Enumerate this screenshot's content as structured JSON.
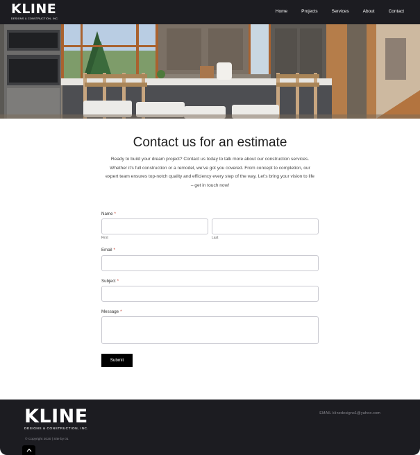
{
  "header": {
    "logo_word": "KLINE",
    "logo_sub": "DESIGNS & CONSTRUCTION, INC.",
    "nav": [
      "Home",
      "Projects",
      "Services",
      "About",
      "Contact"
    ]
  },
  "hero": {
    "alt_icon": "kitchen-photo"
  },
  "main": {
    "title": "Contact us for an estimate",
    "intro": "Ready to build your dream project? Contact us today to talk more about our construction services. Whether it’s full construction or a remodel, we’ve got you covered. From concept to completion, our expert team ensures top-notch quality and efficiency every step of the way. Let’s bring your vision to life – get in touch now!"
  },
  "form": {
    "name_label": "Name",
    "required_mark": "*",
    "first_label": "First",
    "last_label": "Last",
    "email_label": "Email",
    "subject_label": "Subject",
    "message_label": "Message",
    "submit_label": "Submit"
  },
  "footer": {
    "logo_word": "KLINE",
    "logo_sub": "DESIGNS & CONSTRUCTION, INC.",
    "copyright": "© Copyright 2020 | Site by 01",
    "email": "EMAIL klinedesigns1@yahoo.com"
  },
  "colors": {
    "dark": "#1c1c21",
    "accent_required": "#c0392b"
  }
}
